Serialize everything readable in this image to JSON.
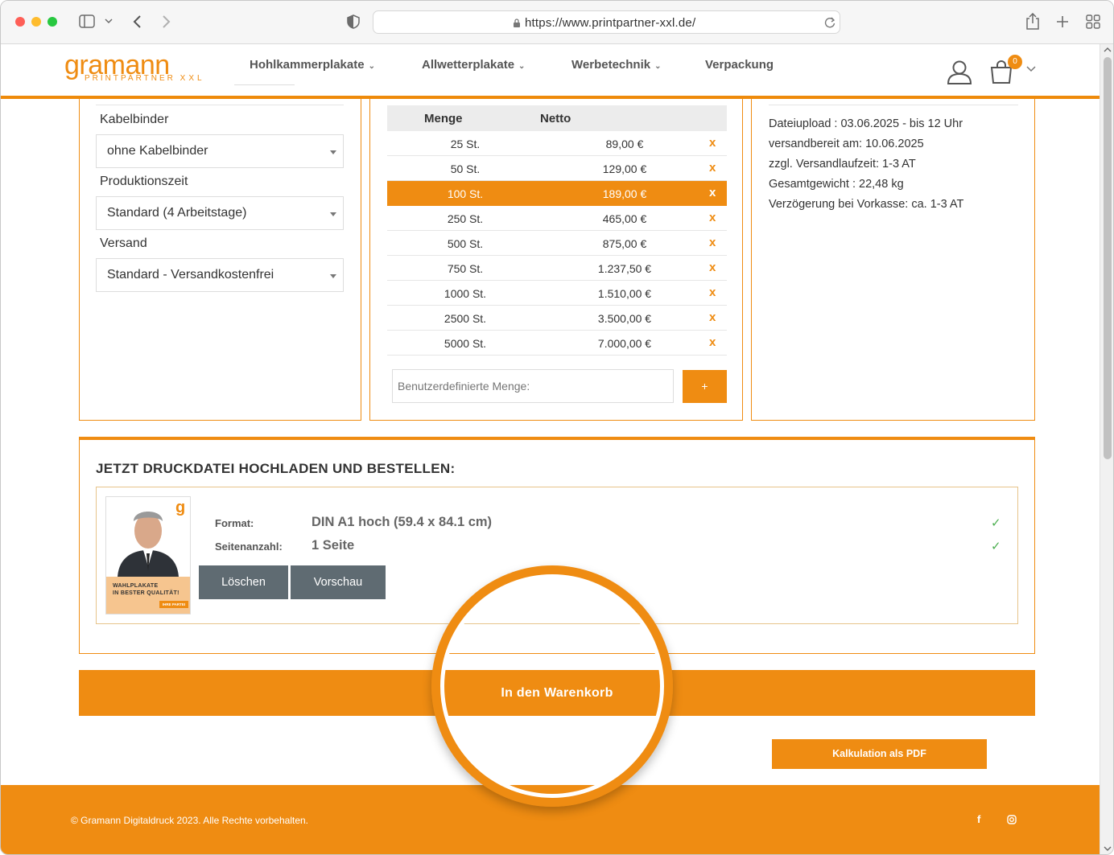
{
  "browser": {
    "url": "https://www.printpartner-xxl.de/"
  },
  "colors": {
    "accent": "#ef8c12",
    "button_gray": "#5f6b72",
    "check_green": "#4caf50"
  },
  "site": {
    "logo_word": "gramann",
    "logo_sub": "PRINTPARTNER",
    "logo_xxl": "XXL",
    "nav": [
      {
        "label": "Hohlkammerplakate",
        "has_dropdown": true
      },
      {
        "label": "Allwetterplakate",
        "has_dropdown": true
      },
      {
        "label": "Werbetechnik",
        "has_dropdown": true
      },
      {
        "label": "Verpackung",
        "has_dropdown": false
      }
    ],
    "cart_count": "0"
  },
  "options": {
    "fields": [
      {
        "label": "Kabelbinder",
        "value": "ohne Kabelbinder"
      },
      {
        "label": "Produktionszeit",
        "value": "Standard (4 Arbeitstage)"
      },
      {
        "label": "Versand",
        "value": "Standard - Versandkostenfrei"
      }
    ]
  },
  "prices": {
    "headers": {
      "qty": "Menge",
      "net": "Netto"
    },
    "rows": [
      {
        "qty": "25 St.",
        "net": "89,00 €",
        "x": "x"
      },
      {
        "qty": "50 St.",
        "net": "129,00 €",
        "x": "x"
      },
      {
        "qty": "100 St.",
        "net": "189,00 €",
        "x": "x"
      },
      {
        "qty": "250 St.",
        "net": "465,00 €",
        "x": "x"
      },
      {
        "qty": "500 St.",
        "net": "875,00 €",
        "x": "x"
      },
      {
        "qty": "750 St.",
        "net": "1.237,50 €",
        "x": "x"
      },
      {
        "qty": "1000 St.",
        "net": "1.510,00 €",
        "x": "x"
      },
      {
        "qty": "2500 St.",
        "net": "3.500,00 €",
        "x": "x"
      },
      {
        "qty": "5000 St.",
        "net": "7.000,00 €",
        "x": "x"
      }
    ],
    "selected_index": 2,
    "custom_placeholder": "Benutzerdefinierte Menge:",
    "add_label": "+"
  },
  "delivery": {
    "lines": [
      "Dateiupload : 03.06.2025 - bis 12 Uhr",
      "versandbereit am: 10.06.2025",
      "zzgl. Versandlaufzeit: 1-3 AT",
      "Gesamtgewicht : 22,48 kg",
      "Verzögerung bei Vorkasse: ca. 1-3 AT"
    ]
  },
  "upload": {
    "title": "JETZT DRUCKDATEI HOCHLADEN UND BESTELLEN:",
    "format_label": "Format:",
    "format_value": "DIN A1 hoch (59.4 x 84.1 cm)",
    "pages_label": "Seitenanzahl:",
    "pages_value": "1 Seite",
    "check": "✓",
    "delete_label": "Löschen",
    "preview_label": "Vorschau",
    "thumb_line1": "WAHLPLAKATE",
    "thumb_line2": "IN BESTER QUALITÄT!",
    "thumb_badge": "IHRE PARTEI",
    "thumb_logo": "g"
  },
  "actions": {
    "add_to_cart": "In den Warenkorb",
    "pdf": "Kalkulation als PDF"
  },
  "footer": {
    "copyright": "© Gramann Digitaldruck 2023. Alle Rechte vorbehalten.",
    "facebook": "f"
  }
}
